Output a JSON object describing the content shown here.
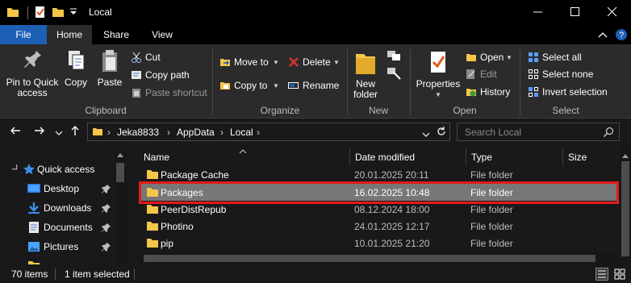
{
  "window": {
    "title": "Local"
  },
  "tabs": {
    "file": "File",
    "home": "Home",
    "share": "Share",
    "view": "View"
  },
  "ribbon": {
    "clipboard": {
      "pin_line1": "Pin to Quick",
      "pin_line2": "access",
      "copy": "Copy",
      "paste": "Paste",
      "cut": "Cut",
      "copy_path": "Copy path",
      "paste_shortcut": "Paste shortcut",
      "group": "Clipboard"
    },
    "organize": {
      "move_to": "Move to",
      "copy_to": "Copy to",
      "delete": "Delete",
      "rename": "Rename",
      "group": "Organize"
    },
    "new": {
      "new_folder_line1": "New",
      "new_folder_line2": "folder",
      "group": "New"
    },
    "open": {
      "properties": "Properties",
      "open": "Open",
      "edit": "Edit",
      "history": "History",
      "group": "Open"
    },
    "select": {
      "select_all": "Select all",
      "select_none": "Select none",
      "invert_selection": "Invert selection",
      "group": "Select"
    }
  },
  "address": {
    "crumbs": [
      "Jeka8833",
      "AppData",
      "Local"
    ],
    "search_placeholder": "Search Local"
  },
  "navpane": {
    "items": [
      {
        "label": "Quick access",
        "icon": "star-icon"
      },
      {
        "label": "Desktop",
        "icon": "desktop-icon",
        "pinned": true
      },
      {
        "label": "Downloads",
        "icon": "download-icon",
        "pinned": true
      },
      {
        "label": "Documents",
        "icon": "documents-icon",
        "pinned": true
      },
      {
        "label": "Pictures",
        "icon": "pictures-icon",
        "pinned": true
      }
    ]
  },
  "filelist": {
    "columns": [
      "Name",
      "Date modified",
      "Type",
      "Size"
    ],
    "rows": [
      {
        "name": "Package Cache",
        "date": "20.01.2025 20:11",
        "type": "File folder"
      },
      {
        "name": "Packages",
        "date": "16.02.2025 10:48",
        "type": "File folder",
        "selected": true
      },
      {
        "name": "PeerDistRepub",
        "date": "08.12.2024 18:00",
        "type": "File folder"
      },
      {
        "name": "Photino",
        "date": "24.01.2025 12:17",
        "type": "File folder"
      },
      {
        "name": "pip",
        "date": "10.01.2025 21:20",
        "type": "File folder"
      }
    ]
  },
  "status": {
    "item_count": "70 items",
    "selected": "1 item selected"
  },
  "colors": {
    "file_tab": "#1d5fb5",
    "selection_highlight": "#e21b1b",
    "folder": "#f4c549"
  }
}
